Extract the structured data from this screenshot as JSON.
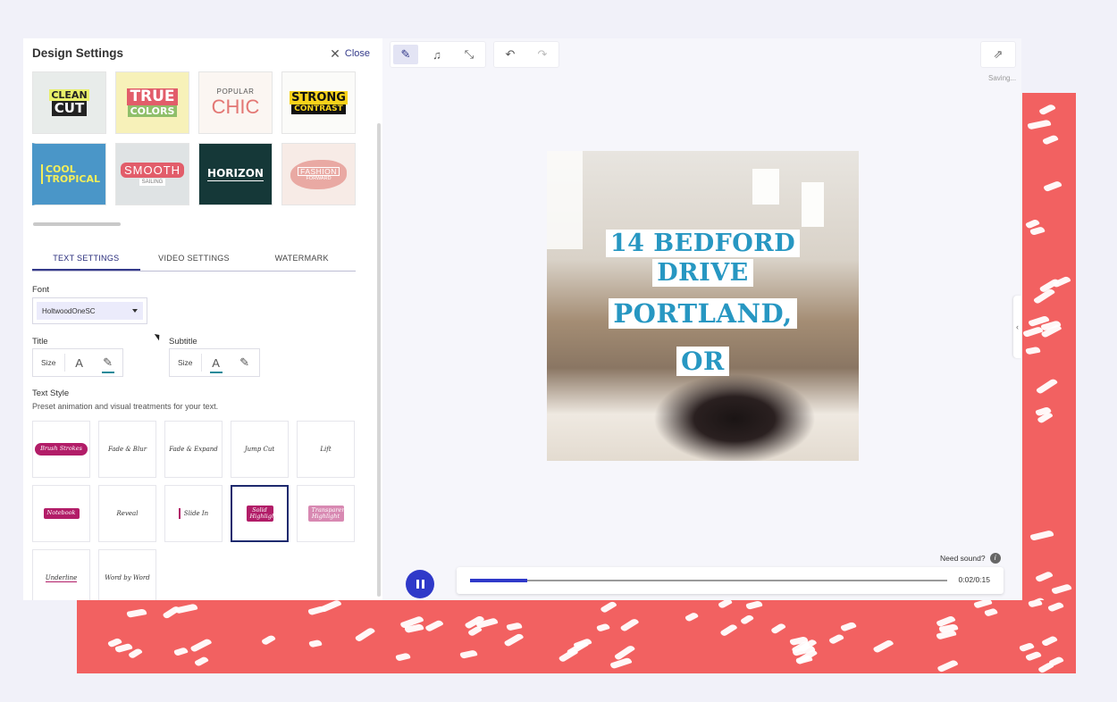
{
  "panel": {
    "title": "Design Settings",
    "close_label": "Close"
  },
  "presets": [
    {
      "line1": "CLEAN",
      "line2": "CUT",
      "bg": "#e8ecea"
    },
    {
      "line1": "TRUE",
      "line2": "COLORS",
      "bg": "#f7f1b9"
    },
    {
      "line1": "POPULAR",
      "line2": "CHIC",
      "bg": "#fbf6f2"
    },
    {
      "line1": "STRONG",
      "line2": "CONTRAST",
      "bg": "#fbfbf9"
    },
    {
      "line1": "COOL",
      "line2": "TROPICAL",
      "bg": "#4a96c8"
    },
    {
      "line1": "SMOOTH",
      "line2": "SAILING",
      "bg": "#dfe3e4"
    },
    {
      "line1": "HORIZON",
      "line2": "",
      "bg": "#153838"
    },
    {
      "line1": "FASHION",
      "line2": "FORWARD",
      "bg": "#f7ebe6"
    }
  ],
  "tabs": {
    "text": "TEXT SETTINGS",
    "video": "VIDEO SETTINGS",
    "watermark": "WATERMARK"
  },
  "font": {
    "label": "Font",
    "value": "HoltwoodOneSC"
  },
  "title_section": {
    "label": "Title",
    "size": "Size"
  },
  "subtitle_section": {
    "label": "Subtitle",
    "size": "Size"
  },
  "text_style": {
    "heading": "Text Style",
    "description": "Preset animation and visual treatments for your text.",
    "items": [
      "Brush Strokes",
      "Fade & Blur",
      "Fade & Expand",
      "Jump Cut",
      "Lift",
      "Notebook",
      "Reveal",
      "Slide In",
      "Solid Highlight",
      "Transparent Highlight",
      "Underline",
      "Word by Word"
    ],
    "selected": "Solid Highlight"
  },
  "editor": {
    "saving": "Saving...",
    "caption_lines": [
      "14 BEDFORD",
      "DRIVE",
      "PORTLAND,",
      "OR"
    ],
    "need_sound": "Need sound?",
    "time": "0:02/0:15",
    "progress": 0.12
  },
  "colors": {
    "accent": "#2f39c9",
    "brand_navy": "#343a8a",
    "caption_blue": "#2797c2",
    "coral": "#f26161",
    "highlight": "#b21d68"
  }
}
